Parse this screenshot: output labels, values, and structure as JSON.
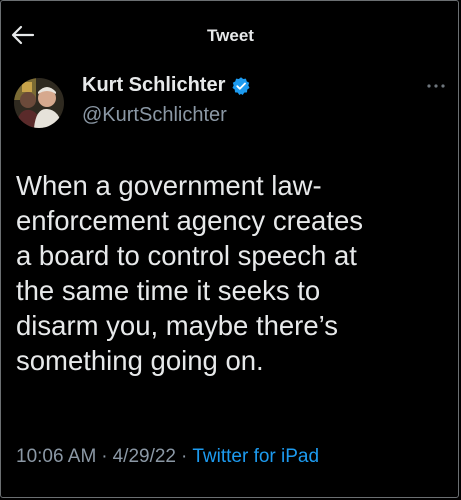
{
  "colors": {
    "background": "#000000",
    "text_primary": "#e7e9ea",
    "text_secondary": "#8b98a5",
    "accent": "#1d9bf0"
  },
  "header": {
    "back_icon": "arrow-left-icon",
    "title": "Tweet"
  },
  "author": {
    "name": "Kurt Schlichter",
    "verified_icon": "verified-badge-icon",
    "handle": "@KurtSchlichter"
  },
  "more_icon": "more-horizontal-icon",
  "tweet": {
    "text": "When a government law-\nenforcement agency creates\na board to control speech at\nthe same time it seeks to\ndisarm you, maybe there’s\nsomething going on."
  },
  "meta": {
    "time": "10:06 AM",
    "separator": "·",
    "date": "4/29/22",
    "source": "Twitter for iPad"
  }
}
